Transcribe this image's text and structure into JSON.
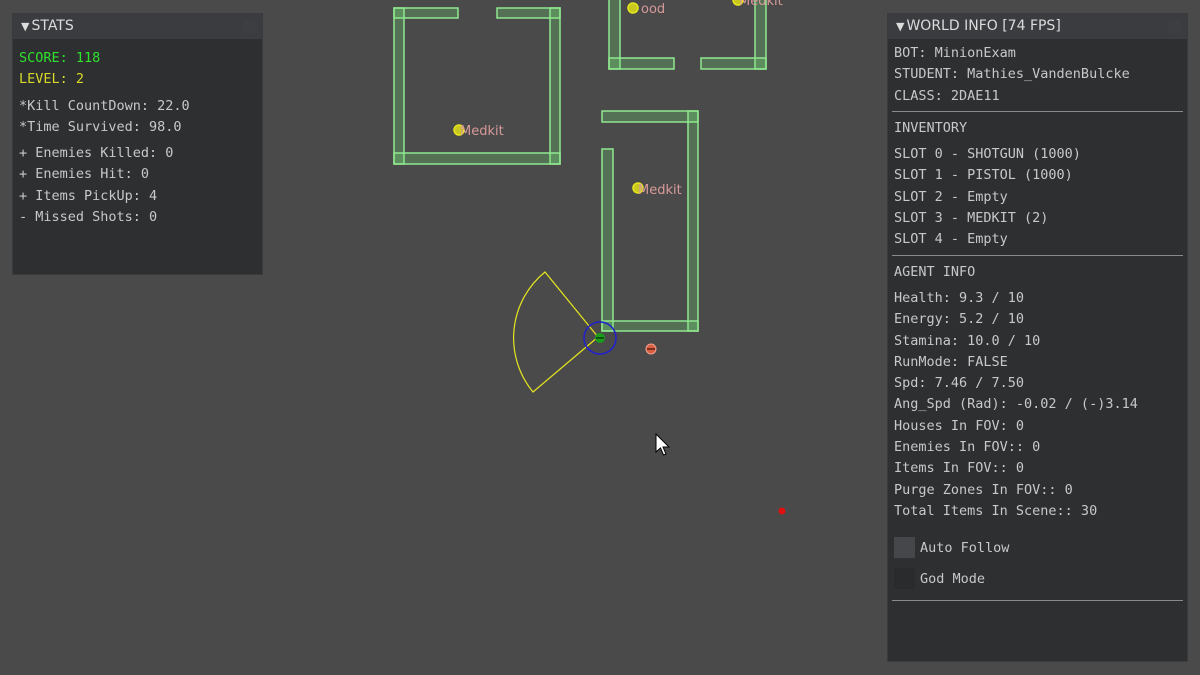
{
  "stats": {
    "title": "STATS",
    "score": "SCORE: 118",
    "level": "LEVEL: 2",
    "kill_countdown": "*Kill CountDown: 22.0",
    "time_survived": "*Time Survived: 98.0",
    "enemies_killed": "+ Enemies Killed: 0",
    "enemies_hit": "+ Enemies Hit: 0",
    "items_pickup": "+ Items PickUp: 4",
    "missed_shots": "- Missed Shots: 0"
  },
  "world_info": {
    "title": "WORLD INFO [74 FPS]",
    "bot": "BOT: MinionExam",
    "student": "STUDENT: Mathies_VandenBulcke",
    "class": "CLASS: 2DAE11",
    "inventory_title": "INVENTORY",
    "slots": [
      "SLOT 0 - SHOTGUN (1000)",
      "SLOT 1 - PISTOL (1000)",
      "SLOT 2 - Empty",
      "SLOT 3 - MEDKIT (2)",
      "SLOT 4 - Empty"
    ],
    "agent_title": "AGENT INFO",
    "agent": [
      "Health: 9.3 / 10",
      "Energy: 5.2 / 10",
      "Stamina: 10.0 / 10",
      "RunMode: FALSE",
      "Spd: 7.46 / 7.50",
      "Ang_Spd (Rad): -0.02 / (-)3.14",
      "Houses In FOV: 0",
      "Enemies In FOV:: 0",
      "Items In FOV:: 0",
      "Purge Zones In FOV:: 0",
      "Total Items In Scene:: 30"
    ],
    "auto_follow": "Auto Follow",
    "god_mode": "God Mode"
  },
  "world": {
    "labels": {
      "food": "ood",
      "medkit_top": "Medkit",
      "medkit_left": "Medkit",
      "medkit_mid": "Medkit"
    },
    "colors": {
      "background": "#4a4a4a",
      "house_wall": "#90e890",
      "item": "#e6e61e",
      "fov_cone": "#e6e61e",
      "agent": "#1a9e1a",
      "agent_ring": "#2020d0",
      "enemy": "#e06040",
      "target": "#e01010"
    }
  }
}
